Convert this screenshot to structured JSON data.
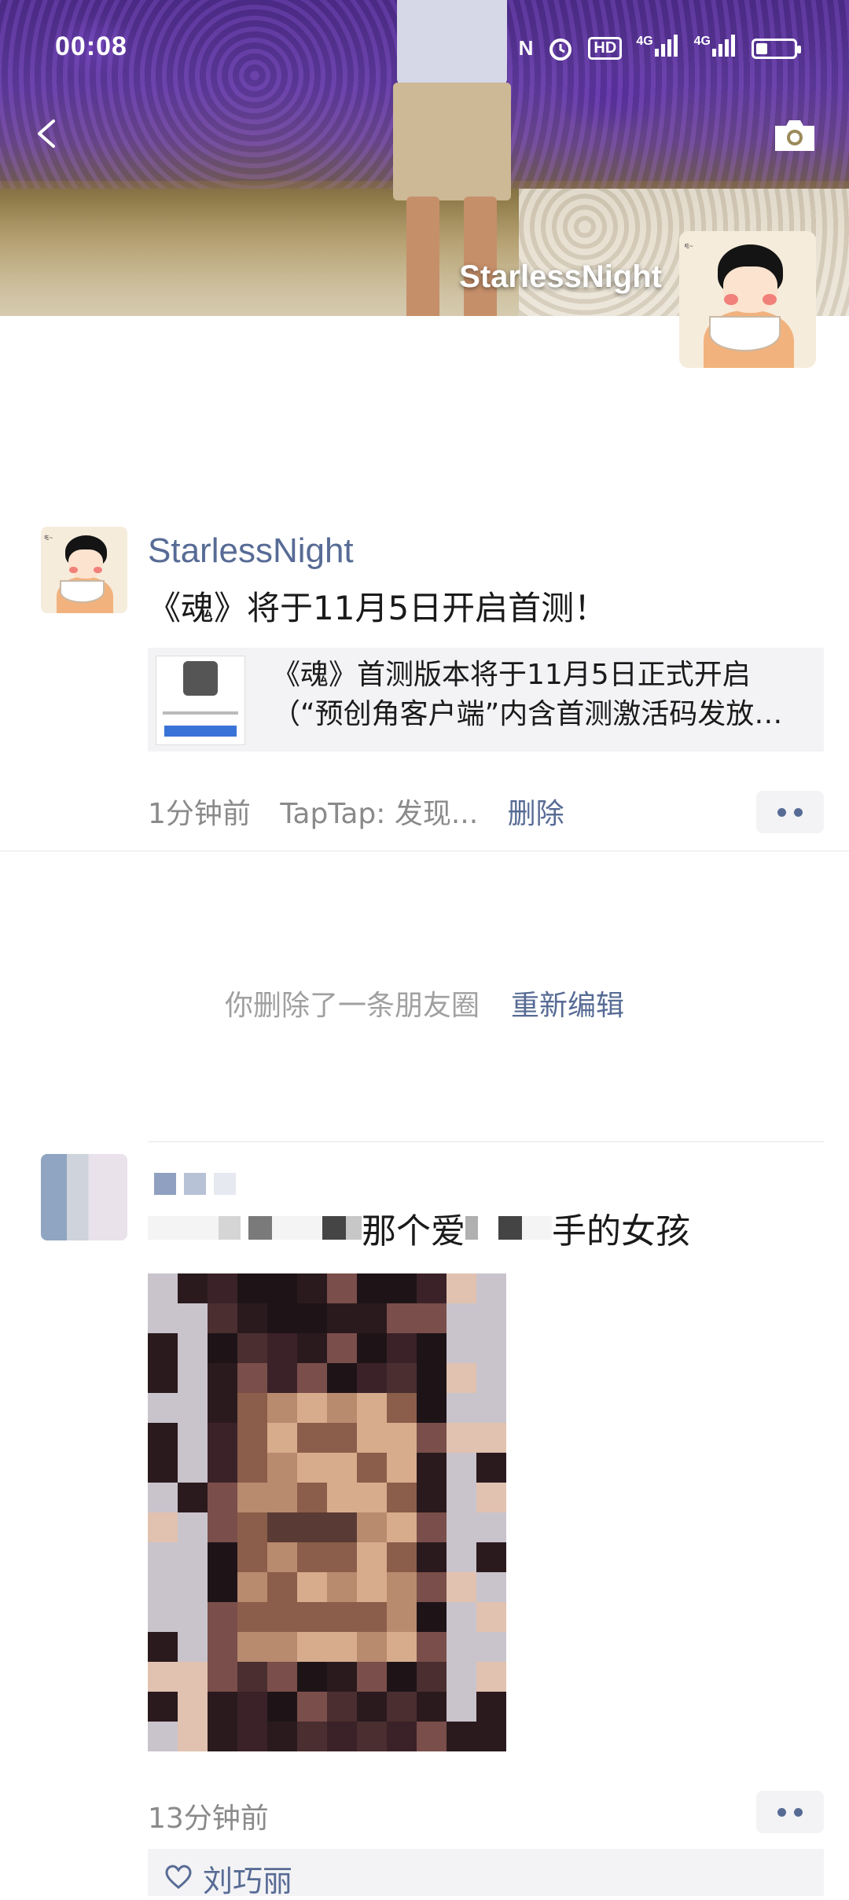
{
  "status_bar": {
    "time": "00:08",
    "nfc": "N",
    "hd": "HD",
    "net1": "4G",
    "net2": "4G"
  },
  "cover": {
    "username": "StarlessNight"
  },
  "post1": {
    "author": "StarlessNight",
    "text": "《魂》将于11月5日开启首测！",
    "link_title_line1": "《魂》首测版本将于11月5日正式开启",
    "link_title_line2": "（“预创角客户端”内含首测激活码发放活...",
    "time": "1分钟前",
    "source": "TapTap: 发现...",
    "delete_label": "删除"
  },
  "deleted_notice": {
    "text": "你删除了一条朋友圈",
    "action": "重新编辑"
  },
  "post2": {
    "text_part1": "那个爱",
    "text_part2": "手的女孩",
    "time": "13分钟前",
    "likes": [
      "刘巧丽"
    ]
  },
  "icons": {
    "back": "back-chevron-icon",
    "camera": "camera-icon",
    "more": "more-dots-icon",
    "heart": "heart-icon"
  },
  "colors": {
    "link_blue": "#576b95",
    "meta_gray": "#8a8a8a",
    "card_bg": "#f3f3f5"
  }
}
